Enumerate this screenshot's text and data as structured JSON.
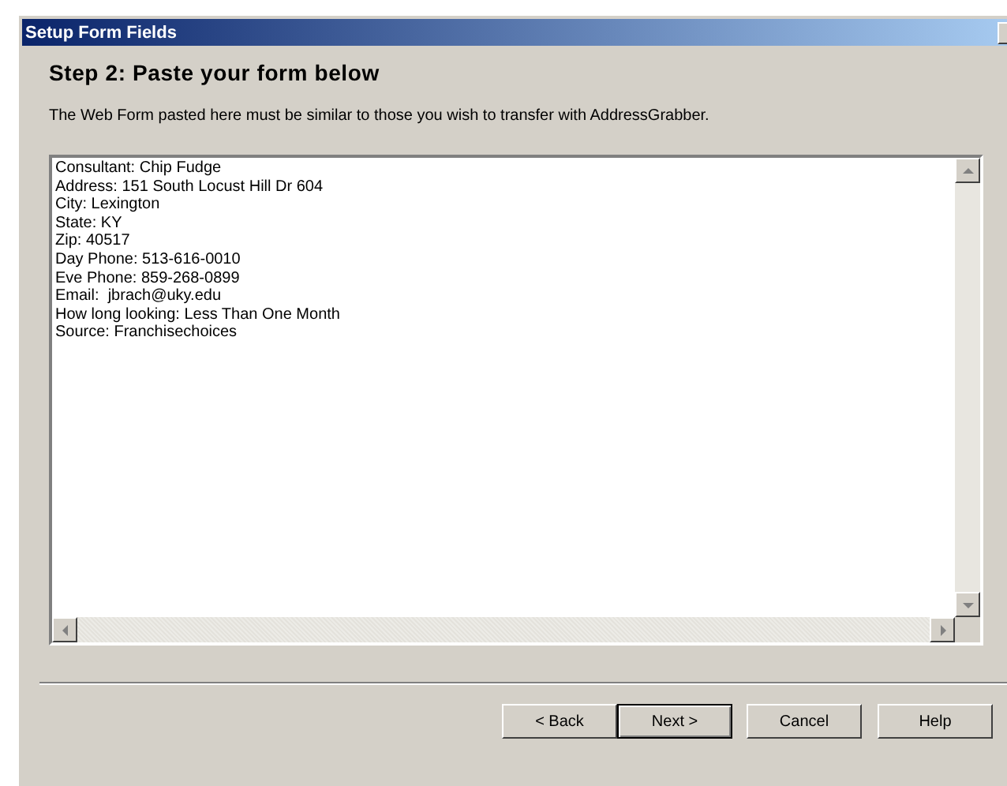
{
  "window": {
    "title": "Setup Form Fields"
  },
  "heading": "Step 2: Paste your form below",
  "description": "The Web Form pasted here must be similar to those you wish to transfer with AddressGrabber.",
  "form_text": "Consultant: Chip Fudge\nAddress: 151 South Locust Hill Dr 604\nCity: Lexington\nState: KY\nZip: 40517\nDay Phone: 513-616-0010\nEve Phone: 859-268-0899\nEmail:  jbrach@uky.edu\nHow long looking: Less Than One Month\nSource: Franchisechoices",
  "buttons": [
    {
      "label": "< Back",
      "default": false
    },
    {
      "label": "Next >",
      "default": true
    },
    {
      "label": "Cancel",
      "default": false
    },
    {
      "label": "Help",
      "default": false
    }
  ]
}
